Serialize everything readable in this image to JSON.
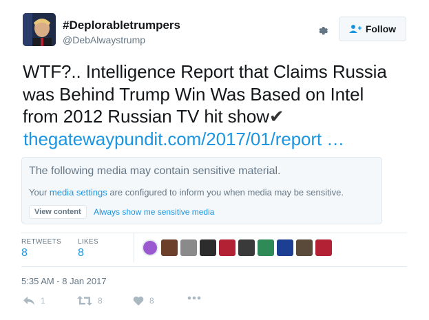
{
  "header": {
    "display_name": "#Deplorabletrumpers",
    "handle": "@DebAlwaystrump",
    "follow_label": "Follow"
  },
  "tweet": {
    "line1": "WTF?.. Intelligence Report that Claims Russia",
    "line2": "was Behind Trump Win Was Based on Intel",
    "line3": "from 2012 Russian TV hit show",
    "checkmark": "✔",
    "link": "thegatewaypundit.com/2017/01/report …"
  },
  "sensitive": {
    "title": "The following media may contain sensitive material.",
    "desc_prefix": "Your ",
    "desc_link": "media settings",
    "desc_suffix": " are configured to inform you when media may be sensitive.",
    "view_button": "View content",
    "always_link": "Always show me sensitive media"
  },
  "stats": {
    "retweets_label": "RETWEETS",
    "retweets_value": "8",
    "likes_label": "LIKES",
    "likes_value": "8"
  },
  "likers": [
    {
      "name": "liker-1",
      "color": "#9b59d0"
    },
    {
      "name": "liker-2",
      "color": "#6b3f2a"
    },
    {
      "name": "liker-3",
      "color": "#8a8a8a"
    },
    {
      "name": "liker-4",
      "color": "#2c2c2c"
    },
    {
      "name": "liker-5",
      "color": "#b22234"
    },
    {
      "name": "liker-6",
      "color": "#3a3a3a"
    },
    {
      "name": "liker-7",
      "color": "#2e8b57"
    },
    {
      "name": "liker-8",
      "color": "#1c3f94"
    },
    {
      "name": "liker-9",
      "color": "#5a4a3a"
    },
    {
      "name": "liker-10",
      "color": "#b22234"
    }
  ],
  "timestamp": "5:35 AM - 8 Jan 2017",
  "actions": {
    "reply_count": "1",
    "retweet_count": "8",
    "like_count": "8"
  },
  "colors": {
    "link": "#1b95e0",
    "muted": "#657786",
    "border": "#e1e8ed",
    "action_gray": "#aab8c2"
  }
}
